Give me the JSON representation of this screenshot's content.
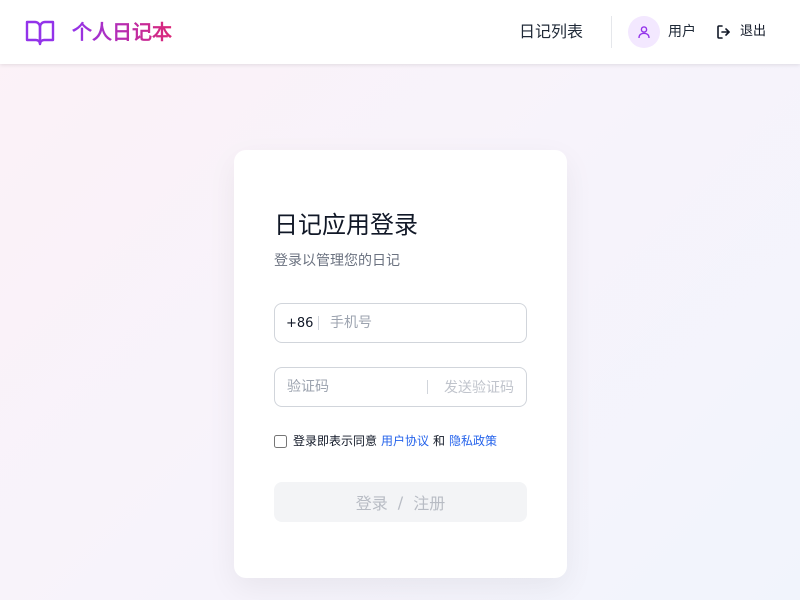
{
  "header": {
    "brand_title": "个人日记本",
    "brand_icon": "book-open-icon",
    "nav_diary_list": "日记列表",
    "user_name": "用户",
    "logout_label": "退出",
    "accent_purple": "#9333ea",
    "accent_pink": "#db2777"
  },
  "login": {
    "title": "日记应用登录",
    "subtitle": "登录以管理您的日记",
    "phone_prefix": "+86",
    "phone_placeholder": "手机号",
    "code_placeholder": "验证码",
    "send_code_label": "发送验证码",
    "agree_text": "登录即表示同意",
    "user_agreement": "用户协议",
    "and_text": "和",
    "privacy_policy": "隐私政策",
    "submit_login": "登录",
    "submit_slash": "/",
    "submit_register": "注册",
    "link_color": "#2563eb"
  }
}
